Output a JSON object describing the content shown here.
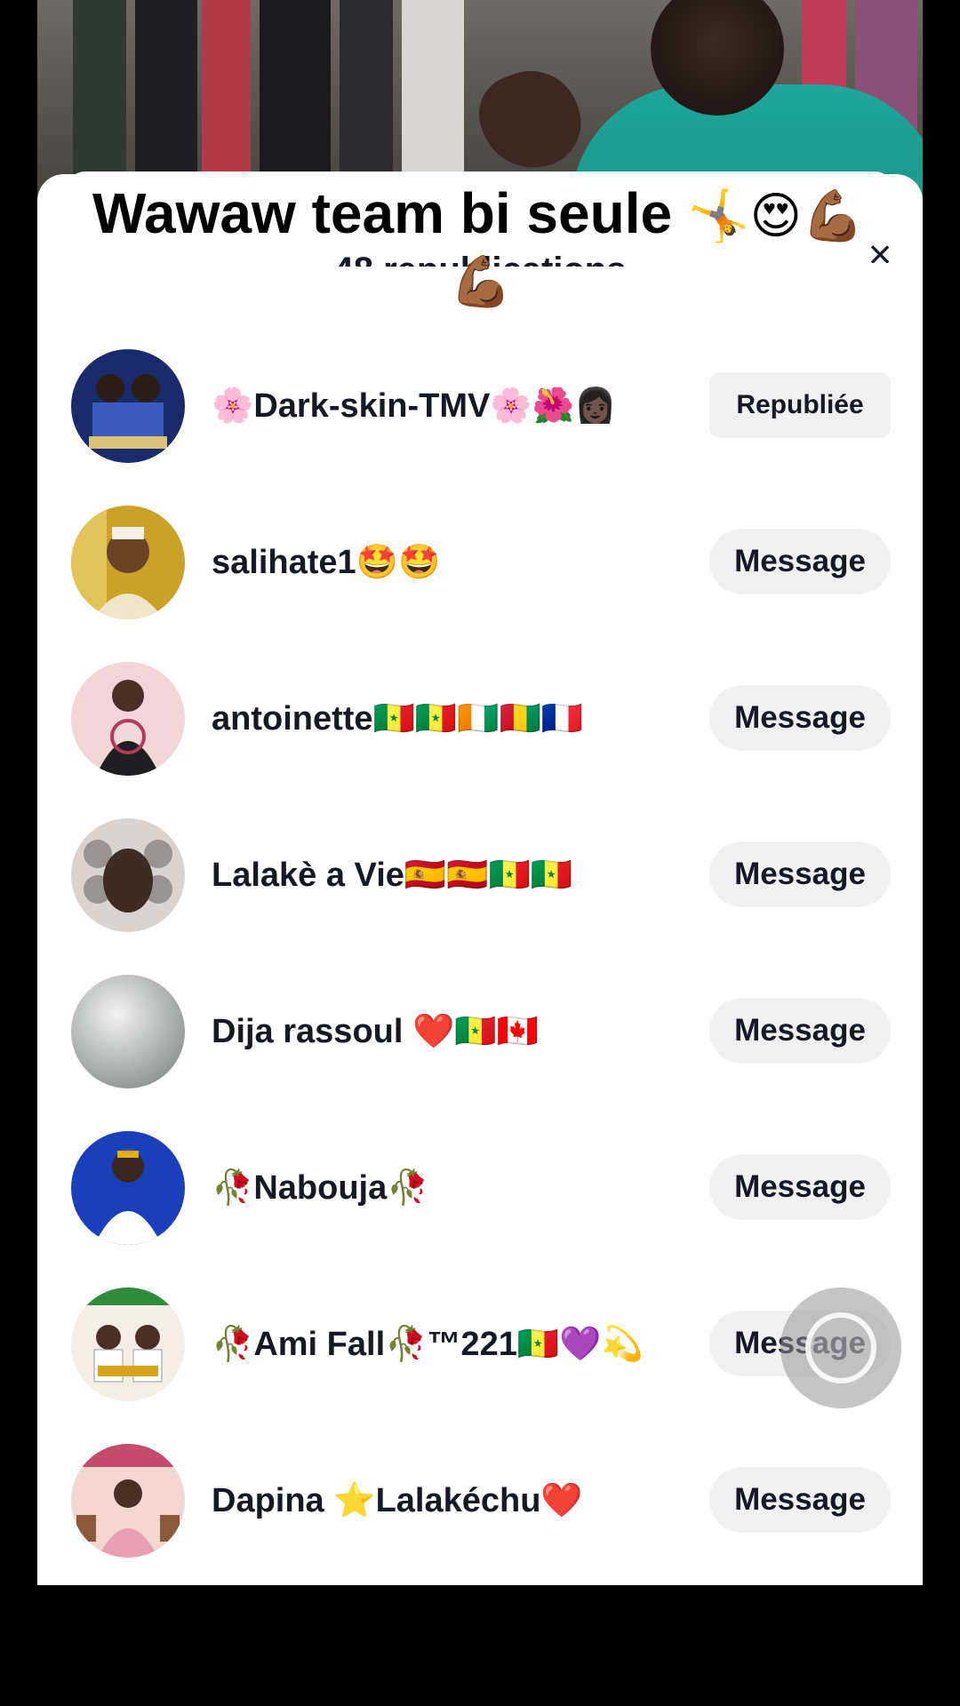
{
  "caption": {
    "text": "Wawaw team bi seule",
    "emojis_line1": "🤸😍💪🏾",
    "emojis_line2": "💪🏾"
  },
  "sheet": {
    "title": "48 republications",
    "close_icon": "close-icon"
  },
  "users": [
    {
      "name": "🌸Dark-skin-TMV🌸🌺👩🏿",
      "button": "Republiée",
      "avatar_colors": [
        "#1b2a6b",
        "#3b5bbf"
      ]
    },
    {
      "name": "salihate1🤩🤩",
      "button": "Message",
      "avatar_colors": [
        "#c9a227",
        "#f1e6c9"
      ]
    },
    {
      "name": "antoinette🇸🇳🇸🇳🇨🇮🇬🇳🇫🇷",
      "button": "Message",
      "avatar_colors": [
        "#f2d6d9",
        "#b03a5b"
      ]
    },
    {
      "name": "Lalakè a Vie🇪🇸🇪🇸🇸🇳🇸🇳",
      "button": "Message",
      "avatar_colors": [
        "#d9d4cf",
        "#3d2c24"
      ]
    },
    {
      "name": "Dija rassoul ❤️🇸🇳🇨🇦",
      "button": "Message",
      "avatar_colors": [
        "#e6e8e6",
        "#8f9390"
      ]
    },
    {
      "name": "🥀Nabouja🥀",
      "button": "Message",
      "avatar_colors": [
        "#1b3fb8",
        "#ffffff"
      ]
    },
    {
      "name": "🥀Ami Fall🥀™221🇸🇳💜💫",
      "button": "Message",
      "avatar_colors": [
        "#f4efe6",
        "#2e8b3a"
      ]
    },
    {
      "name": "Dapina ⭐Lalakéchu❤️",
      "button": "Message",
      "avatar_colors": [
        "#f3d7d0",
        "#c24b6e"
      ]
    }
  ],
  "colors": {
    "button_bg": "#f1f1f2",
    "text": "#161823",
    "shirt": "#1fa69a"
  }
}
